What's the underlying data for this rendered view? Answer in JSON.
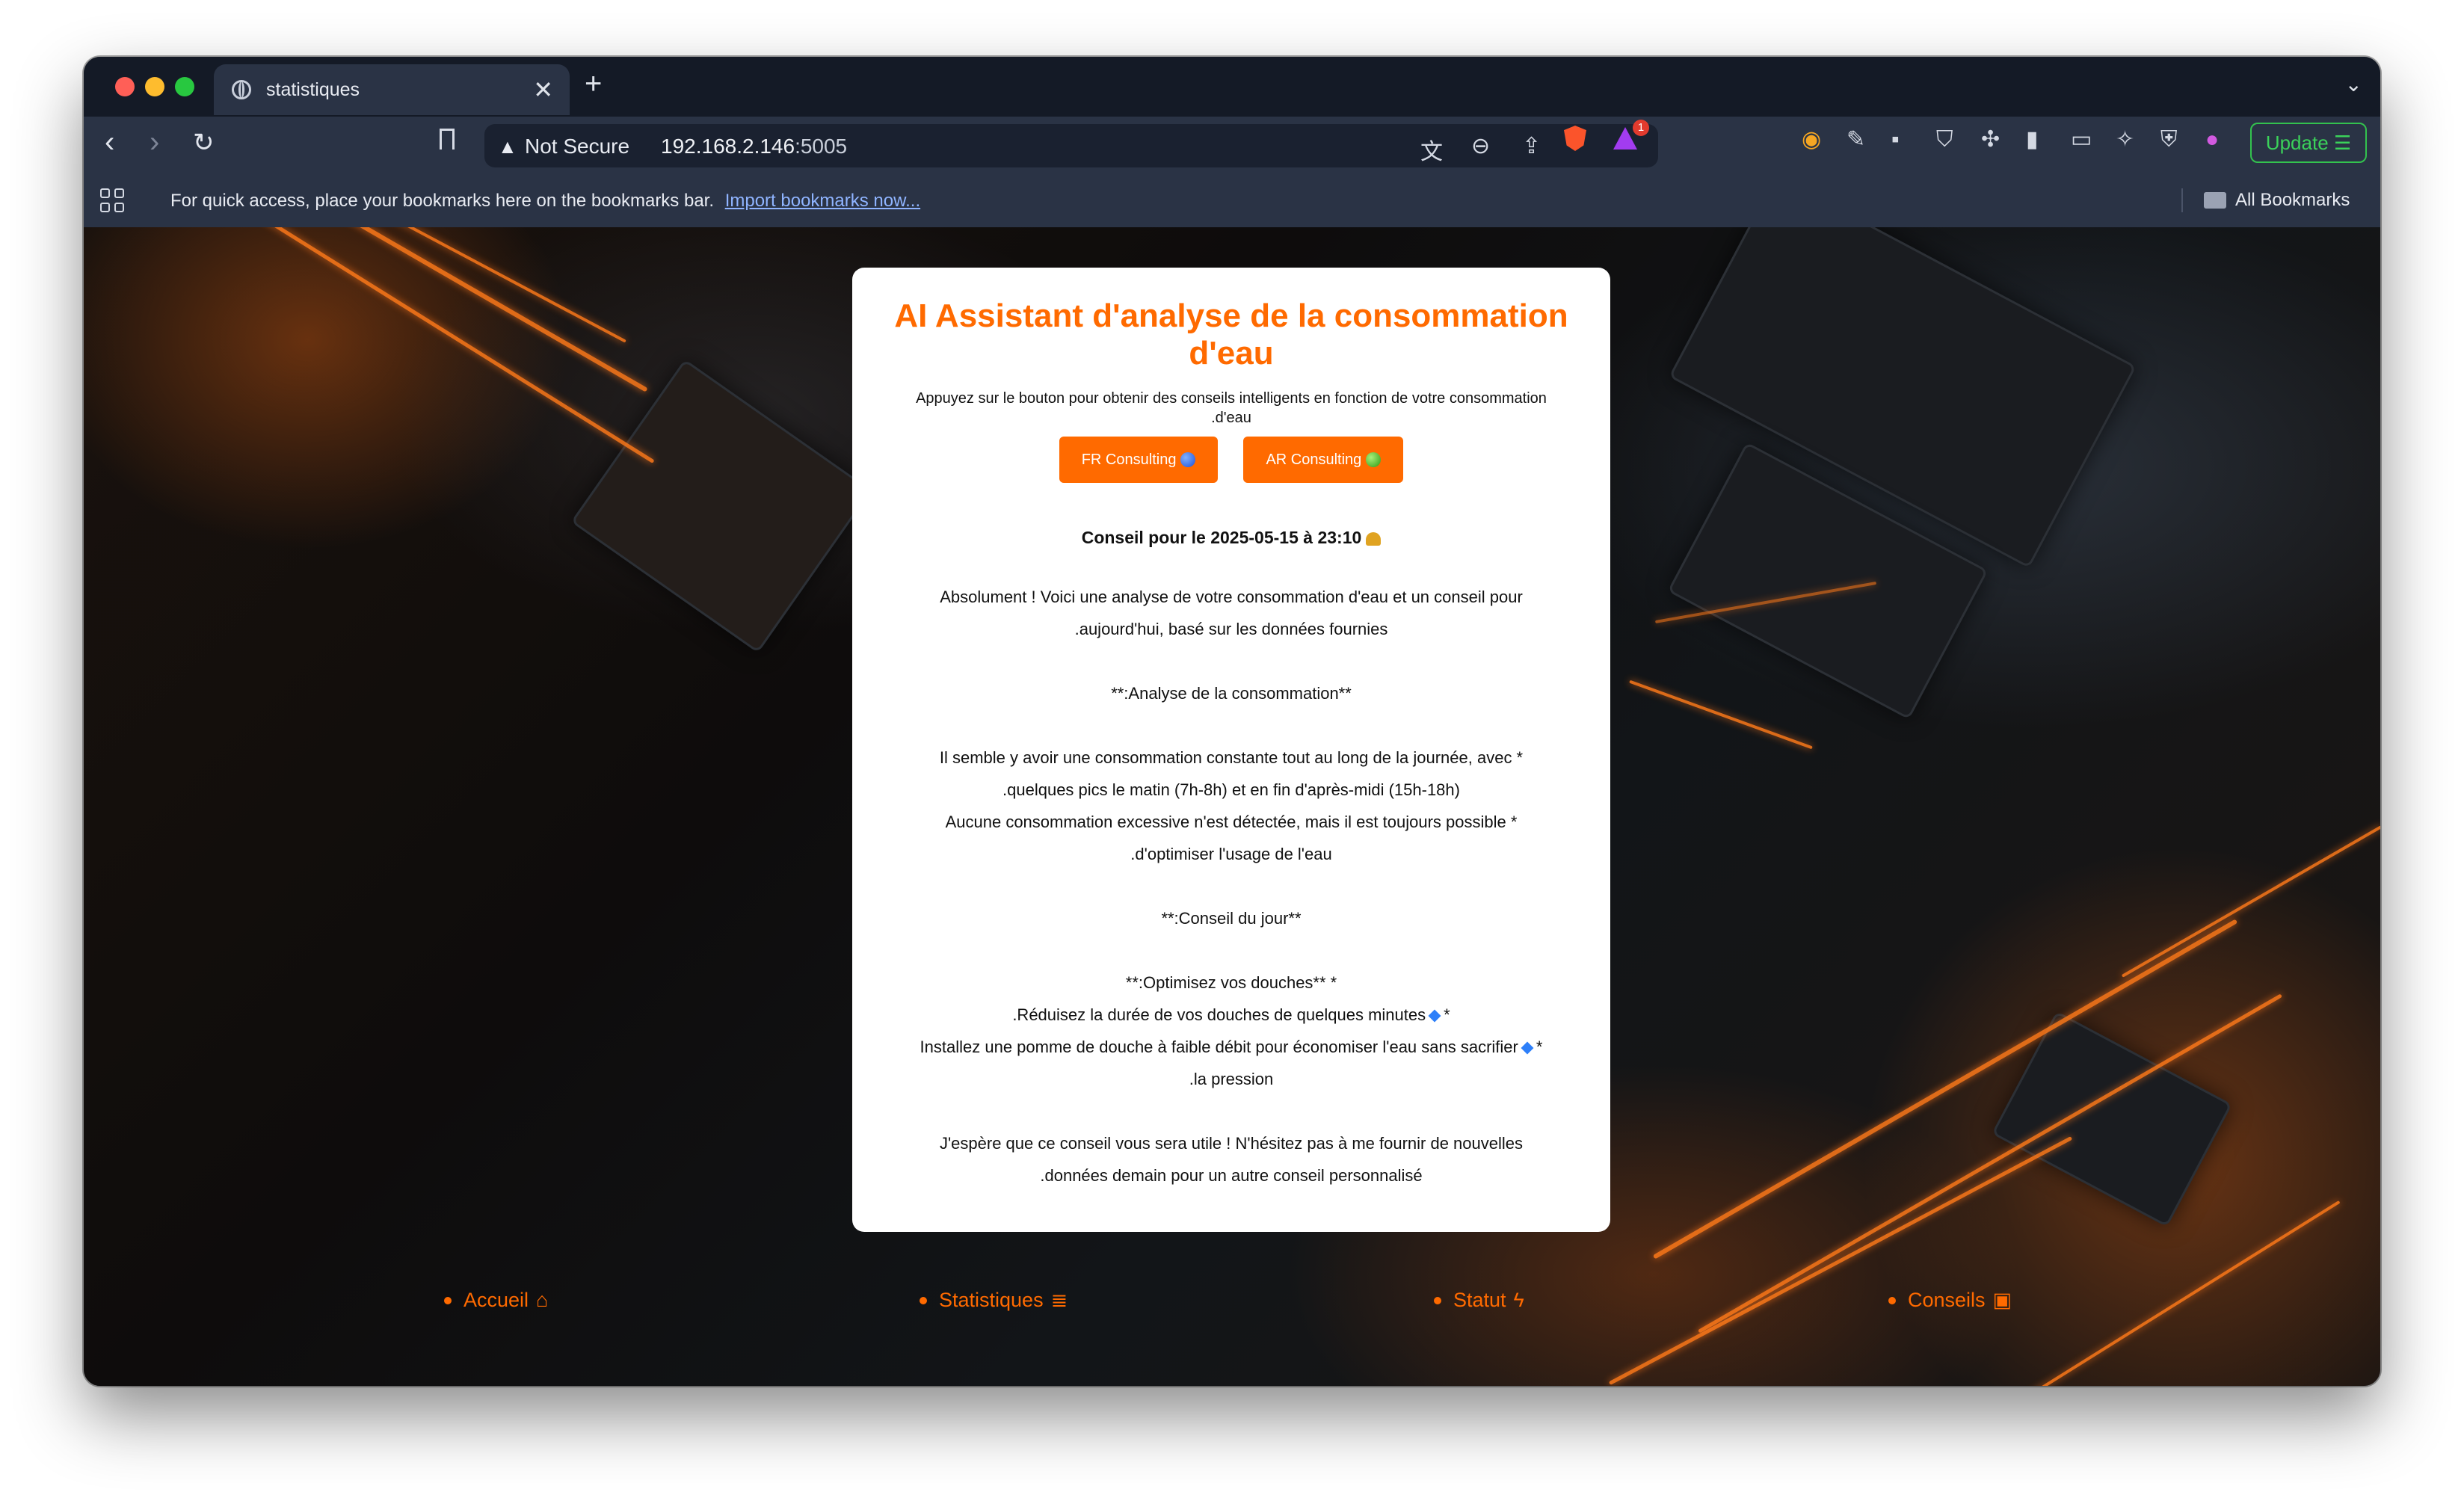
{
  "browser": {
    "tab_title": "statistiques",
    "tab_close": "✕",
    "new_tab": "+",
    "security_label": "Not Secure",
    "url_host": "192.168.2.146",
    "url_port": ":5005",
    "rewards_badge": "1",
    "update_label": "Update ☰",
    "bookmarks_prompt": "For quick access, place your bookmarks here on the bookmarks bar.",
    "import_link": "Import bookmarks now...",
    "all_bookmarks": "All Bookmarks"
  },
  "card": {
    "title": "AI Assistant d'analyse de la consommation d'eau",
    "subtitle_line1": "Appuyez sur le bouton pour obtenir des conseils intelligents en fonction de votre consommation",
    "subtitle_line2": ".d'eau",
    "buttons": [
      {
        "label": "FR Consulting"
      },
      {
        "label": "AR Consulting"
      }
    ],
    "advice_title": "Conseil pour le 2025-05-15 à 23:10",
    "lines": [
      "Absolument ! Voici une analyse de votre consommation d'eau et un conseil pour",
      ".aujourd'hui, basé sur les données fournies",
      "**:Analyse de la consommation**",
      "Il semble y avoir une consommation constante tout au long de la journée, avec *",
      ".quelques pics le matin (7h-8h) et en fin d'après-midi (15h-18h)",
      "Aucune consommation excessive n'est détectée, mais il est toujours possible *",
      ".d'optimiser l'usage de l'eau",
      "**:Conseil du jour**",
      "**:Optimisez vos douches** *",
      ".Réduisez la durée de vos douches de quelques minutes",
      "Installez une pomme de douche à faible débit pour économiser l'eau sans sacrifier",
      ".la pression",
      "J'espère que ce conseil vous sera utile ! N'hésitez pas à me fournir de nouvelles",
      ".données demain pour un autre conseil personnalisé"
    ],
    "bullet_suffix": "*"
  },
  "footer": {
    "links": [
      {
        "label": "Accueil",
        "icon": "home-icon"
      },
      {
        "label": "Statistiques",
        "icon": "chart-icon"
      },
      {
        "label": "Statut",
        "icon": "bolt-icon"
      },
      {
        "label": "Conseils",
        "icon": "robot-icon"
      }
    ]
  },
  "colors": {
    "accent": "#ff6a00",
    "update_green": "#3bd15a"
  }
}
